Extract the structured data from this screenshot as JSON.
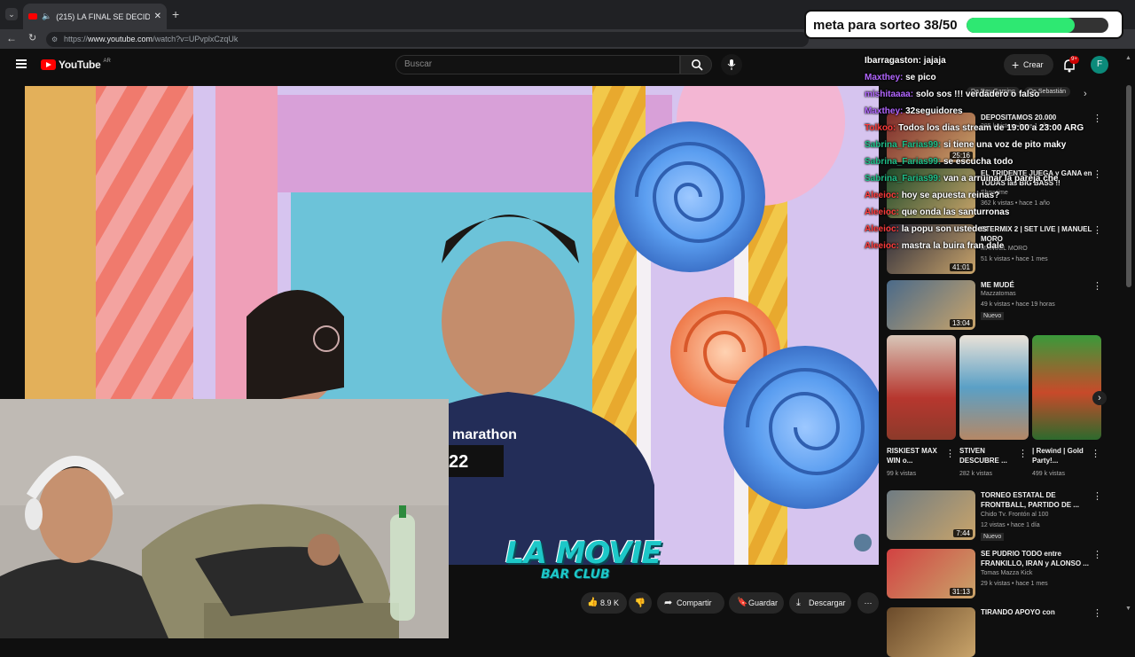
{
  "browser": {
    "tab_title": "(215) LA FINAL SE DECIDE en",
    "url_prefix": "https://",
    "url_domain": "www.youtube.com",
    "url_path": "/watch?v=UPvplxCzqUk"
  },
  "youtube": {
    "logo_text": "YouTube",
    "region": "AR",
    "search_placeholder": "Buscar",
    "create_label": "Crear",
    "notif_count": "9+",
    "avatar_letter": "F"
  },
  "video": {
    "jersey_text": "marathon",
    "number_text": "22",
    "like_count": "8.9 K",
    "share_label": "Compartir",
    "save_label": "Guardar",
    "download_label": "Descargar"
  },
  "overlay": {
    "goal_label": "meta para sorteo 38/50",
    "goal_current": 38,
    "goal_total": 50,
    "goal_color": "#2ee872",
    "stream_logo_line1": "LA MOVIE",
    "stream_logo_line2": "BAR CLUB"
  },
  "chat": [
    {
      "user": "Ibarragaston:",
      "msg": "jajaja",
      "color": "#ffffff"
    },
    {
      "user": "Maxthey:",
      "msg": "se pico",
      "color": "#b266ff"
    },
    {
      "user": "mishitaaaa:",
      "msg": "solo sos !!! verdadero o falso",
      "color": "#b266ff"
    },
    {
      "user": "Maxthey:",
      "msg": "32seguidores",
      "color": "#b266ff"
    },
    {
      "user": "Tolkoo:",
      "msg": "Todos los dias stream de 19:00 a 23:00 ARG",
      "color": "#ff3b3b"
    },
    {
      "user": "Sabrina_Farias99:",
      "msg": "si tiene una voz de pito maky",
      "color": "#1fc08a"
    },
    {
      "user": "Sabrina_Farias99:",
      "msg": "se escucha todo",
      "color": "#1fc08a"
    },
    {
      "user": "Sabrina_Farias99:",
      "msg": "van a arruinar la pareja che",
      "color": "#1fc08a"
    },
    {
      "user": "Aleeioc:",
      "msg": "hoy se apuesta reinas?",
      "color": "#ff3b3b"
    },
    {
      "user": "Aleeioc:",
      "msg": "que onda las santurronas",
      "color": "#ff3b3b"
    },
    {
      "user": "Aleeioc:",
      "msg": "la popu son ustedes",
      "color": "#ff3b3b"
    },
    {
      "user": "Aleeioc:",
      "msg": "mastra la buira fran dale",
      "color": "#ff3b3b"
    }
  ],
  "sidebar": {
    "chip_label": "De Rey Gaming",
    "chip_label2": "De Sebastián",
    "videos": [
      {
        "title": "DEPOSITAMOS 20.000",
        "channel": "",
        "meta": "385 k vistas • hace 1 año",
        "duration": "25:16"
      },
      {
        "title": "EL TRIDENTE JUEGA y GANA en TODAS las BIG BASS !!",
        "channel": "Showtime",
        "meta": "362 k vistas • hace 1 año",
        "duration": ""
      },
      {
        "title": "ETERMIX 2 | SET LIVE | MANUEL MORO",
        "channel": "MANUEL MORO",
        "meta": "51 k vistas • hace 1 mes",
        "duration": "41:01"
      },
      {
        "title": "ME MUDÉ",
        "channel": "Mazzatomas",
        "meta": "49 k vistas • hace 19 horas",
        "duration": "13:04",
        "badge": "Nuevo"
      }
    ],
    "shorts": [
      {
        "title": "RISKIEST MAX WIN o...",
        "views": "99 k vistas"
      },
      {
        "title": "STIVEN DESCUBRE ...",
        "views": "282 k vistas"
      },
      {
        "title": "| Rewind | Gold Party!...",
        "views": "499 k vistas"
      }
    ],
    "videos2": [
      {
        "title": "TORNEO ESTATAL DE FRONTBALL, PARTIDO DE ...",
        "channel": "Chido Tv. Frontón al 100",
        "meta": "12 vistas • hace 1 día",
        "duration": "7:44",
        "badge": "Nuevo"
      },
      {
        "title": "SE PUDRIO TODO entre FRANKILLO, IRAN y ALONSO ...",
        "channel": "Tomas Mazza Kick",
        "meta": "29 k vistas • hace 1 mes",
        "duration": "31:13"
      },
      {
        "title": "TIRANDO APOYO con",
        "channel": "",
        "meta": "",
        "duration": ""
      }
    ]
  }
}
